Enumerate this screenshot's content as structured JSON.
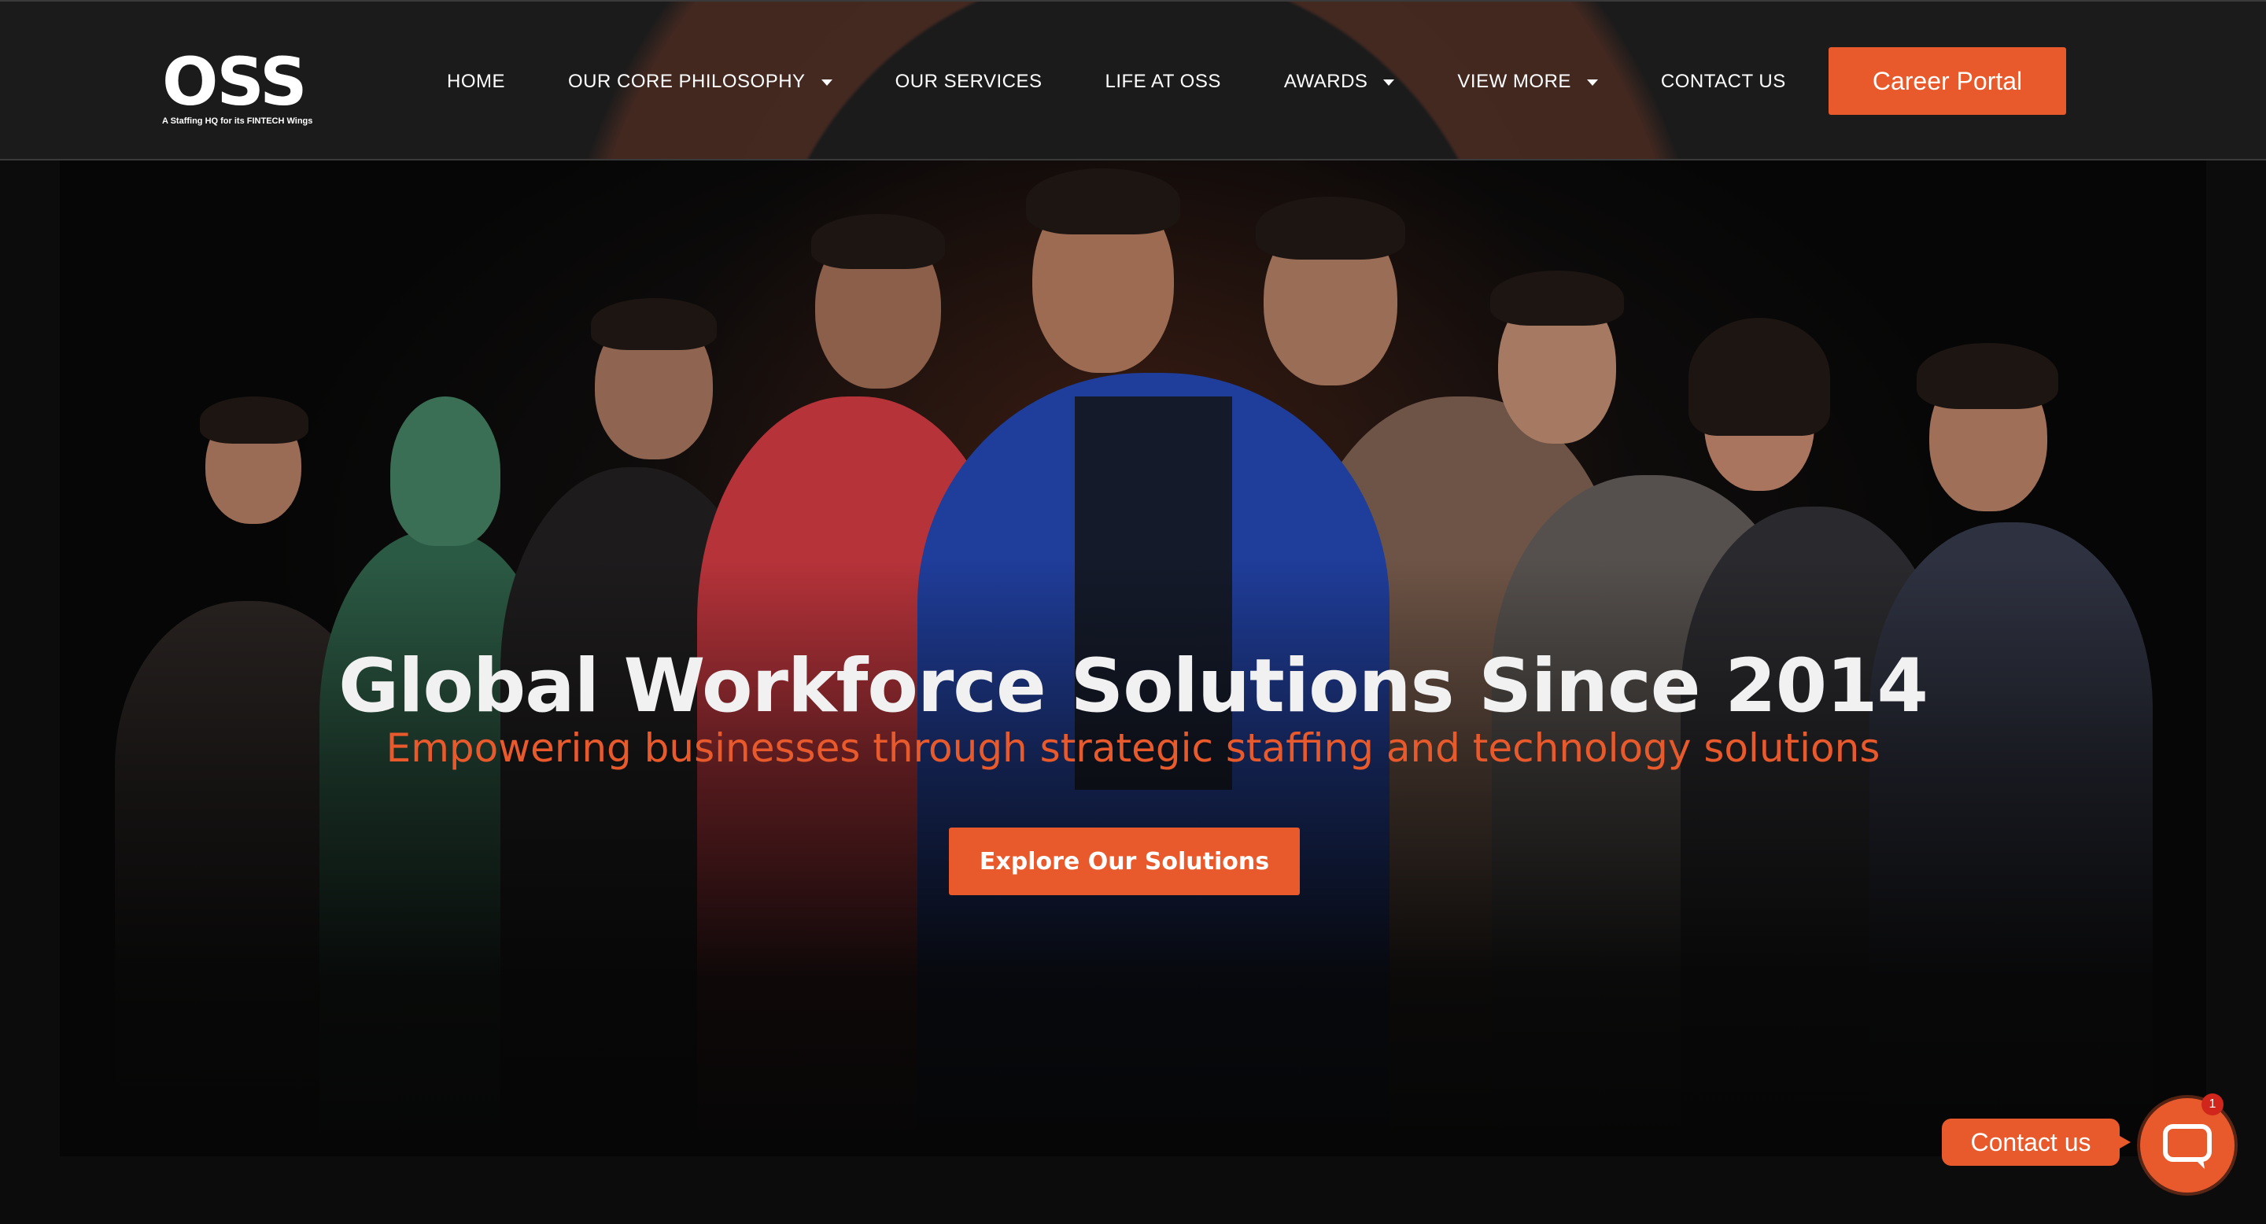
{
  "brand": {
    "name": "OSS",
    "tagline": "A Staffing HQ for its FINTECH Wings",
    "accent_color": "#e8592b"
  },
  "nav": {
    "items": [
      {
        "label": "HOME",
        "has_dropdown": false
      },
      {
        "label": "OUR CORE PHILOSOPHY",
        "has_dropdown": true
      },
      {
        "label": "OUR SERVICES",
        "has_dropdown": false
      },
      {
        "label": "LIFE AT OSS",
        "has_dropdown": false
      },
      {
        "label": "AWARDS",
        "has_dropdown": true
      },
      {
        "label": "VIEW MORE",
        "has_dropdown": true
      },
      {
        "label": "CONTACT US",
        "has_dropdown": false
      }
    ],
    "cta_label": "Career Portal"
  },
  "hero": {
    "title": "Global Workforce Solutions Since 2014",
    "subtitle": "Empowering businesses through strategic staffing and technology solutions",
    "cta_label": "Explore Our Solutions",
    "image": "team-group-photo"
  },
  "chat_widget": {
    "label": "Contact us",
    "badge_count": "1",
    "icon": "chat-bubble-icon"
  }
}
